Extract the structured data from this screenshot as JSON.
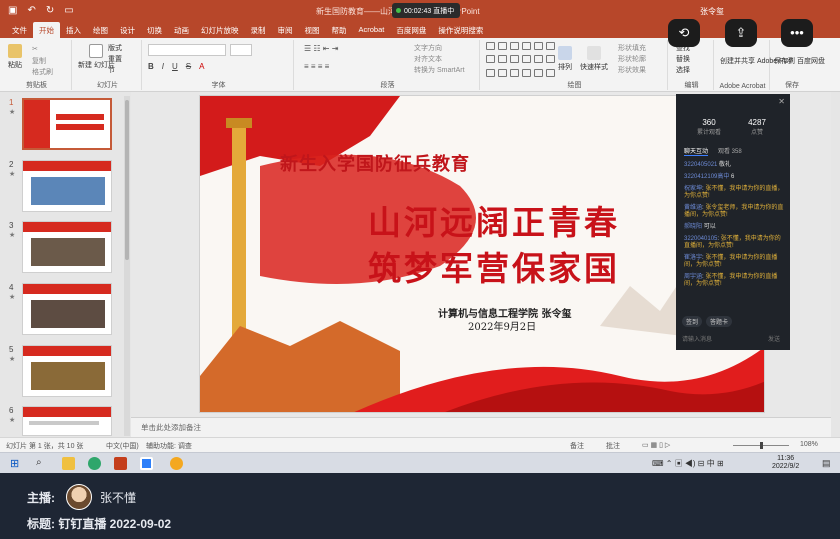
{
  "window": {
    "doc_title": "新生国防教育——山河…… .pptx - PowerPoint",
    "rec_time": "00:02:43",
    "rec_label": "直播中",
    "user": "张令玺"
  },
  "ribbon_tabs": [
    "文件",
    "开始",
    "插入",
    "绘图",
    "设计",
    "切换",
    "动画",
    "幻灯片放映",
    "录制",
    "审阅",
    "视图",
    "帮助",
    "Acrobat",
    "百度网盘",
    "操作说明搜索"
  ],
  "ribbon": {
    "paste": "粘贴",
    "clipboard": "剪贴板",
    "new_slide": "新建\n幻灯片",
    "slides": "幻灯片",
    "layout": "版式",
    "reset": "重置",
    "section": "节",
    "font": "字体",
    "paragraph": "段落",
    "text_direction": "文字方向",
    "align_text": "对齐文本",
    "smartart": "转换为 SmartArt",
    "arrange": "排列",
    "quick_styles": "快速样式",
    "drawing": "绘图",
    "shape_fill": "形状填充",
    "shape_outline": "形状轮廓",
    "shape_effects": "形状效果",
    "find": "查找",
    "replace": "替换",
    "select": "选择",
    "editing": "编辑",
    "create_pdf": "创建并共享\nAdobe PDF",
    "adobe_group": "Adobe Acrobat",
    "save_baidu": "保存到\n百度网盘",
    "save_group": "保存",
    "copy": "复制",
    "format_painter": "格式刷"
  },
  "thumbnails": [
    {
      "num": "1",
      "star": "★"
    },
    {
      "num": "2",
      "star": "★"
    },
    {
      "num": "3",
      "star": "★"
    },
    {
      "num": "4",
      "star": "★"
    },
    {
      "num": "5",
      "star": "★"
    },
    {
      "num": "6",
      "star": "★"
    }
  ],
  "slide": {
    "subtitle": "新生入学国防征兵教育",
    "title_line1": "山河远阔正青春",
    "title_line2": "筑梦军营保家国",
    "author": "计算机与信息工程学院 张令玺",
    "date": "2022年9月2日"
  },
  "live_panel": {
    "viewers": "360",
    "viewers_label": "累计观看",
    "likes": "4287",
    "likes_label": "点赞",
    "tab_chat": "聊天互动",
    "tab_viewers": "观看 358",
    "messages": [
      {
        "name": "3220405021",
        "text": "敬礼"
      },
      {
        "name": "3220412109高中",
        "text": "6"
      },
      {
        "name": "祝家坤",
        "text": "张不懂，我申请为你的直播，为你点赞!"
      },
      {
        "name": "黄维涵",
        "text": "张令玺老师，我申请为你的直播间，为你点赞!"
      },
      {
        "name": "郝晓阳",
        "text": "可以"
      },
      {
        "name": "3220040105",
        "text": "张不懂，我申请为你的直播间，为你点赞!"
      },
      {
        "name": "崔洛宇",
        "text": "张不懂，我申请为你的直播间，为你点赞!"
      },
      {
        "name": "周宇涵",
        "text": "张不懂，我申请为你的直播间，为你点赞!"
      }
    ],
    "chip1": "签到",
    "chip2": "答题卡",
    "input_placeholder": "请输入消息",
    "send": "发送"
  },
  "notes": "单击此处添加备注",
  "status": {
    "slide_pos": "幻灯片 第 1 张，共 10 张",
    "lang": "中文(中国)",
    "accessibility": "辅助功能: 调查",
    "notes_btn": "备注",
    "comments_btn": "批注",
    "zoom": "108%"
  },
  "taskbar": {
    "time": "11:36",
    "date": "2022/9/2"
  },
  "bottom": {
    "host_label": "主播:",
    "host_name": "张不懂",
    "title": "标题: 钉钉直播 2022-09-02"
  },
  "colors": {
    "ppt_accent": "#b7472a",
    "slide_red": "#c81219",
    "live_bg": "#1f2329",
    "bottom_bg": "#1e2634"
  },
  "icons": [
    "camera-switch-icon",
    "share-icon",
    "more-icon",
    "windows-start-icon",
    "search-icon"
  ]
}
